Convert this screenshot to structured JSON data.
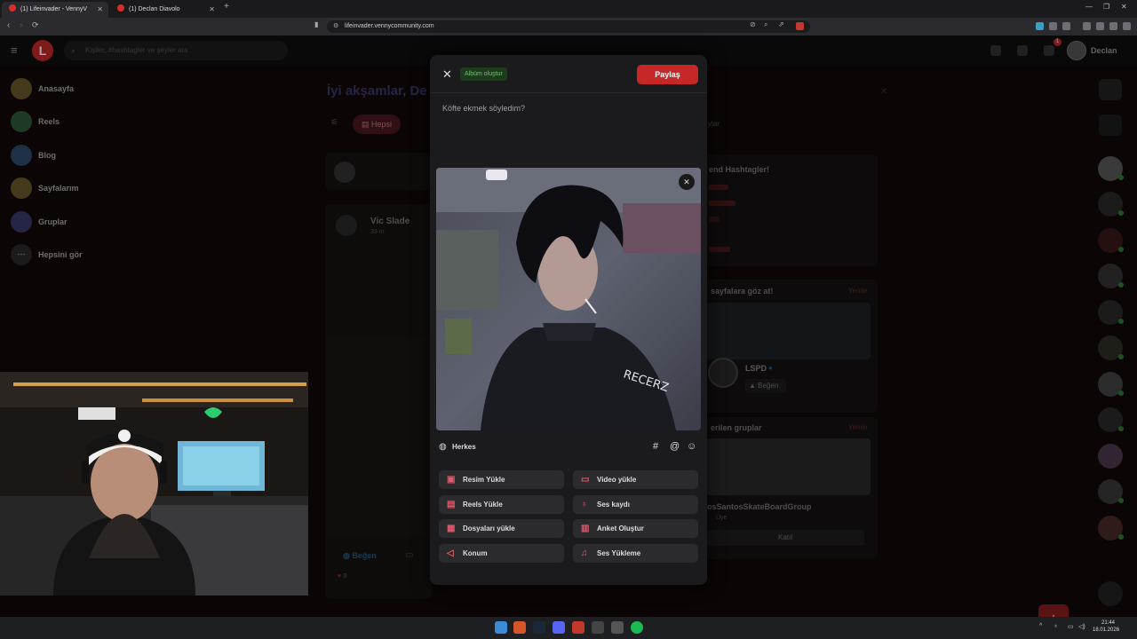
{
  "browser": {
    "tabs": [
      {
        "title": "(1) Lifeinvader - VennyV",
        "active": true
      },
      {
        "title": "(1) Declan Diavolo",
        "active": false
      }
    ],
    "url": "lifeinvader.vennycommunity.com"
  },
  "topnav": {
    "search_placeholder": "Kişiler, #hashtagler ve şeyler ara",
    "user_name": "Declan",
    "notification_count": "1"
  },
  "sidebar": {
    "items": [
      {
        "label": "Anasayfa",
        "color": "#6b5a2a"
      },
      {
        "label": "Reels",
        "color": "#2e5a3a"
      },
      {
        "label": "Blog",
        "color": "#2e4a6b"
      },
      {
        "label": "Sayfalarım",
        "color": "#6b5a2a"
      },
      {
        "label": "Gruplar",
        "color": "#3a3a6b"
      },
      {
        "label": "Hepsini gör",
        "color": "#2a2a2a"
      }
    ]
  },
  "feed": {
    "greeting": "İyi akşamlar, De",
    "filter_all": "Hepsi",
    "post_author": "Vic Slade",
    "post_time": "33 m",
    "like_label": "Beğen",
    "reaction_count": "3"
  },
  "right_column": {
    "trends_title": "end Hashtagler!",
    "pages_title": "sayfalara göz at!",
    "refresh": "Yenile",
    "page_name": "LSPD",
    "page_like": "Beğen",
    "groups_title": "erilen gruplar",
    "group_name": "osSantosSkateBoardGroup",
    "group_meta": "Üye",
    "group_join": "Katıl",
    "tab_partial": "ylar"
  },
  "modal": {
    "album_button": "Albüm oluştur",
    "share_button": "Paylaş",
    "post_text": "Köfte ekmek söyledim?",
    "audience": "Herkes",
    "options": [
      {
        "label": "Resim Yükle",
        "icon": "image-icon",
        "color": "#e05a6a"
      },
      {
        "label": "Video yükle",
        "icon": "video-icon",
        "color": "#e05a6a"
      },
      {
        "label": "Reels Yükle",
        "icon": "reels-icon",
        "color": "#e05a6a"
      },
      {
        "label": "Ses kaydı",
        "icon": "microphone-icon",
        "color": "#e05a6a"
      },
      {
        "label": "Dosyaları yükle",
        "icon": "file-icon",
        "color": "#e05a6a"
      },
      {
        "label": "Anket Oluştur",
        "icon": "poll-icon",
        "color": "#e05a6a"
      },
      {
        "label": "Konum",
        "icon": "location-icon",
        "color": "#e05a6a"
      },
      {
        "label": "Ses Yükleme",
        "icon": "music-icon",
        "color": "#e05a6a"
      }
    ]
  },
  "taskbar": {
    "time": "21:44",
    "date": "18.01.2026"
  }
}
